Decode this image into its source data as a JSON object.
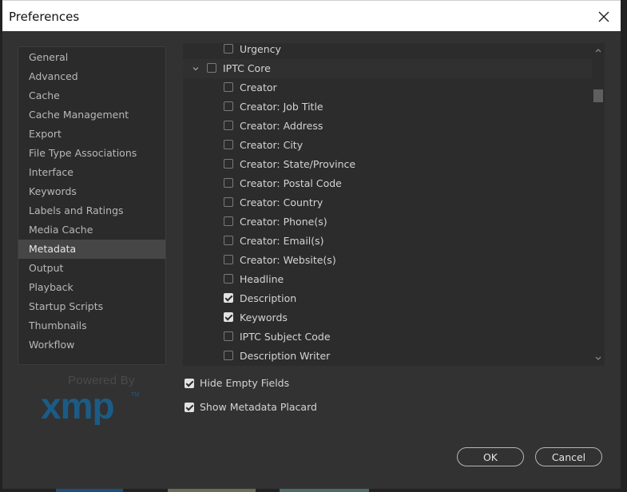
{
  "window": {
    "title": "Preferences"
  },
  "sidebar": {
    "items": [
      {
        "label": "General"
      },
      {
        "label": "Advanced"
      },
      {
        "label": "Cache"
      },
      {
        "label": "Cache Management"
      },
      {
        "label": "Export"
      },
      {
        "label": "File Type Associations"
      },
      {
        "label": "Interface"
      },
      {
        "label": "Keywords"
      },
      {
        "label": "Labels and Ratings"
      },
      {
        "label": "Media Cache"
      },
      {
        "label": "Metadata"
      },
      {
        "label": "Output"
      },
      {
        "label": "Playback"
      },
      {
        "label": "Startup Scripts"
      },
      {
        "label": "Thumbnails"
      },
      {
        "label": "Workflow"
      }
    ],
    "selected": "Metadata"
  },
  "logo": {
    "powered_by": "Powered By",
    "brand": "xmp",
    "brand_color": "#1a5c86"
  },
  "metadata_tree": {
    "rows": [
      {
        "label": "Urgency",
        "checked": false,
        "level": 1
      },
      {
        "label": "IPTC Core",
        "checked": false,
        "level": 0,
        "expanded": true
      },
      {
        "label": "Creator",
        "checked": false,
        "level": 1
      },
      {
        "label": "Creator: Job Title",
        "checked": false,
        "level": 1
      },
      {
        "label": "Creator: Address",
        "checked": false,
        "level": 1
      },
      {
        "label": "Creator: City",
        "checked": false,
        "level": 1
      },
      {
        "label": "Creator: State/Province",
        "checked": false,
        "level": 1
      },
      {
        "label": "Creator: Postal Code",
        "checked": false,
        "level": 1
      },
      {
        "label": "Creator: Country",
        "checked": false,
        "level": 1
      },
      {
        "label": "Creator: Phone(s)",
        "checked": false,
        "level": 1
      },
      {
        "label": "Creator: Email(s)",
        "checked": false,
        "level": 1
      },
      {
        "label": "Creator: Website(s)",
        "checked": false,
        "level": 1
      },
      {
        "label": "Headline",
        "checked": false,
        "level": 1
      },
      {
        "label": "Description",
        "checked": true,
        "level": 1
      },
      {
        "label": "Keywords",
        "checked": true,
        "level": 1
      },
      {
        "label": "IPTC Subject Code",
        "checked": false,
        "level": 1
      },
      {
        "label": "Description Writer",
        "checked": false,
        "level": 1
      }
    ]
  },
  "options": {
    "hide_empty_fields": {
      "label": "Hide Empty Fields",
      "checked": true
    },
    "show_metadata_placard": {
      "label": "Show Metadata Placard",
      "checked": true
    }
  },
  "buttons": {
    "ok": "OK",
    "cancel": "Cancel"
  }
}
